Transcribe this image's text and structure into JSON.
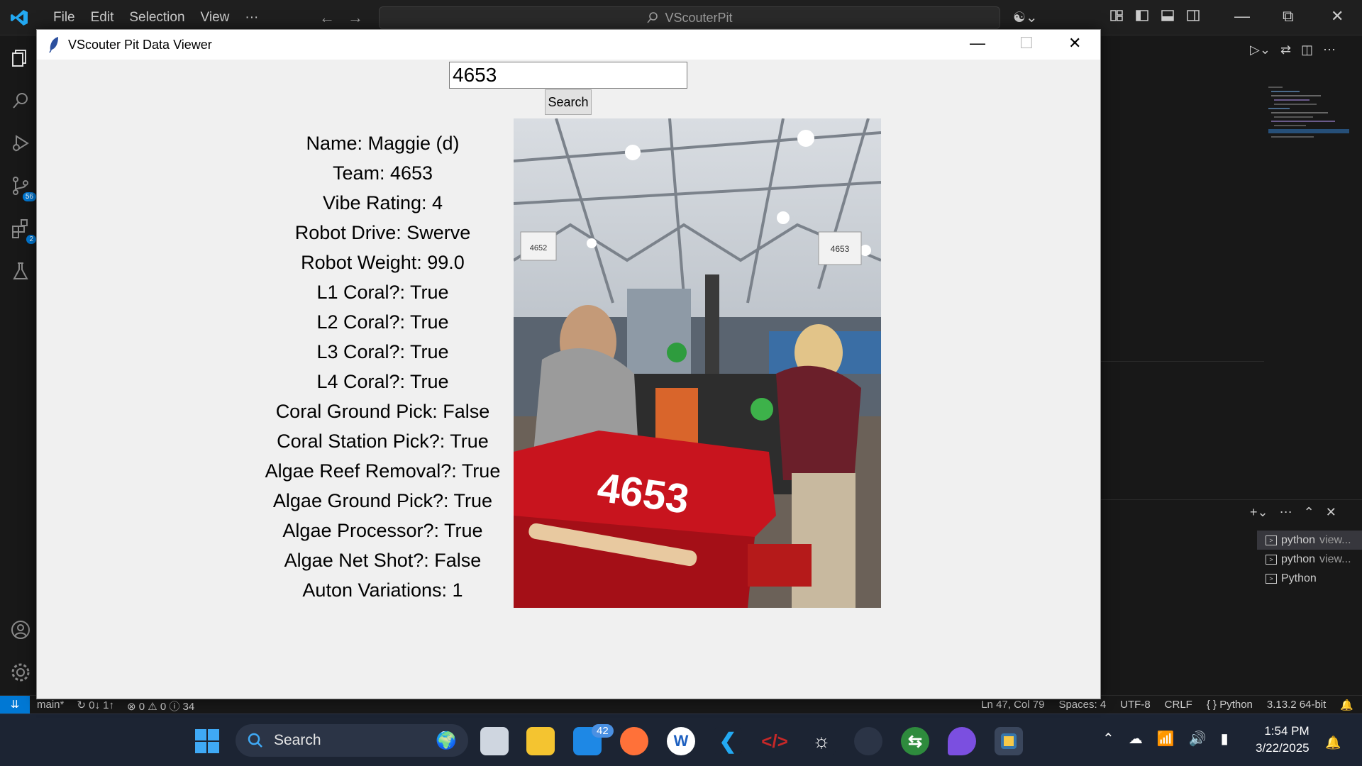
{
  "vscode": {
    "menu": [
      "File",
      "Edit",
      "Selection",
      "View",
      "···"
    ],
    "command_center": "VScouterPit",
    "activity_badges": {
      "source_control": "56",
      "extensions": "2"
    },
    "terminals": [
      {
        "name": "python",
        "detail": "view...",
        "active": true
      },
      {
        "name": "python",
        "detail": "view...",
        "active": false
      },
      {
        "name": "Python",
        "detail": "",
        "active": false
      }
    ],
    "status_left": [
      "main*",
      "↻ 0↓ 1↑",
      "⊗ 0 ⚠ 0 ⓘ 34"
    ],
    "status_right": [
      "Ln 47, Col 79",
      "Spaces: 4",
      "UTF-8",
      "CRLF",
      "{ } Python",
      "3.13.2 64-bit"
    ]
  },
  "app": {
    "title": "VScouter Pit Data Viewer",
    "search_value": "4653",
    "search_button": "Search",
    "fields": [
      "Name: Maggie (d)",
      "Team: 4653",
      "Vibe Rating: 4",
      "Robot Drive: Swerve",
      "Robot Weight: 99.0",
      "L1 Coral?: True",
      "L2 Coral?: True",
      "L3 Coral?: True",
      "L4 Coral?: True",
      "Coral Ground Pick: False",
      "Coral Station Pick?: True",
      "Algae Reef Removal?: True",
      "Algae Ground Pick?: True",
      "Algae Processor?: True",
      "Algae Net Shot?: False",
      "Auton Variations: 1"
    ],
    "photo": {
      "bumper_number": "4653",
      "sign_left": "4652",
      "sign_right": "4653"
    }
  },
  "taskbar": {
    "search": "Search",
    "mail_badge": "42",
    "time": "1:54 PM",
    "date": "3/22/2025"
  },
  "colors": {
    "accent": "#0078d4",
    "vscode_bg": "#1f1f1f",
    "taskbar_bg": "#1c2433",
    "window_bg": "#f0f0f0",
    "bumper_red": "#c8141e"
  }
}
